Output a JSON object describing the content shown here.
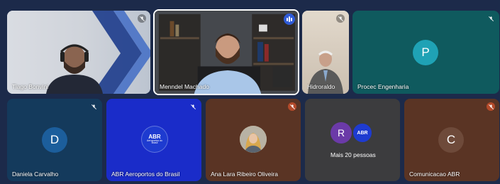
{
  "meeting": {
    "participants": [
      {
        "name": "Tiago Bonvini",
        "type": "video"
      },
      {
        "name": "Menndel Machado",
        "type": "video",
        "speaking": true
      },
      {
        "name": "Hidroraldo",
        "type": "video"
      },
      {
        "name": "Procec Engenharia",
        "type": "avatar",
        "initial": "P"
      },
      {
        "name": "Daniela Carvalho",
        "type": "avatar",
        "initial": "D"
      },
      {
        "name": "ABR Aeroportos do Brasil",
        "type": "logo",
        "logo_text": "ABR",
        "logo_sub": "Aeroportos do Brasil"
      },
      {
        "name": "Ana Lara Ribeiro Oliveira",
        "type": "photo"
      },
      {
        "name": "Mais 20 pessoas",
        "type": "overflow",
        "initial": "R",
        "logo_text": "ABR"
      },
      {
        "name": "Comunicacao ABR",
        "type": "avatar",
        "initial": "C"
      }
    ]
  },
  "colors": {
    "background": "#1c2a4a",
    "teal_tile": "#0f5a5e",
    "blue_tile": "#1a2cc9",
    "brown_tile": "#5a3424",
    "gray_tile": "#3c3c3e",
    "navy_tile": "#143a5c",
    "speaking_border": "#ffffff"
  },
  "icons": {
    "muted_mic": "mic-off-icon",
    "speaking": "audio-level-icon"
  }
}
